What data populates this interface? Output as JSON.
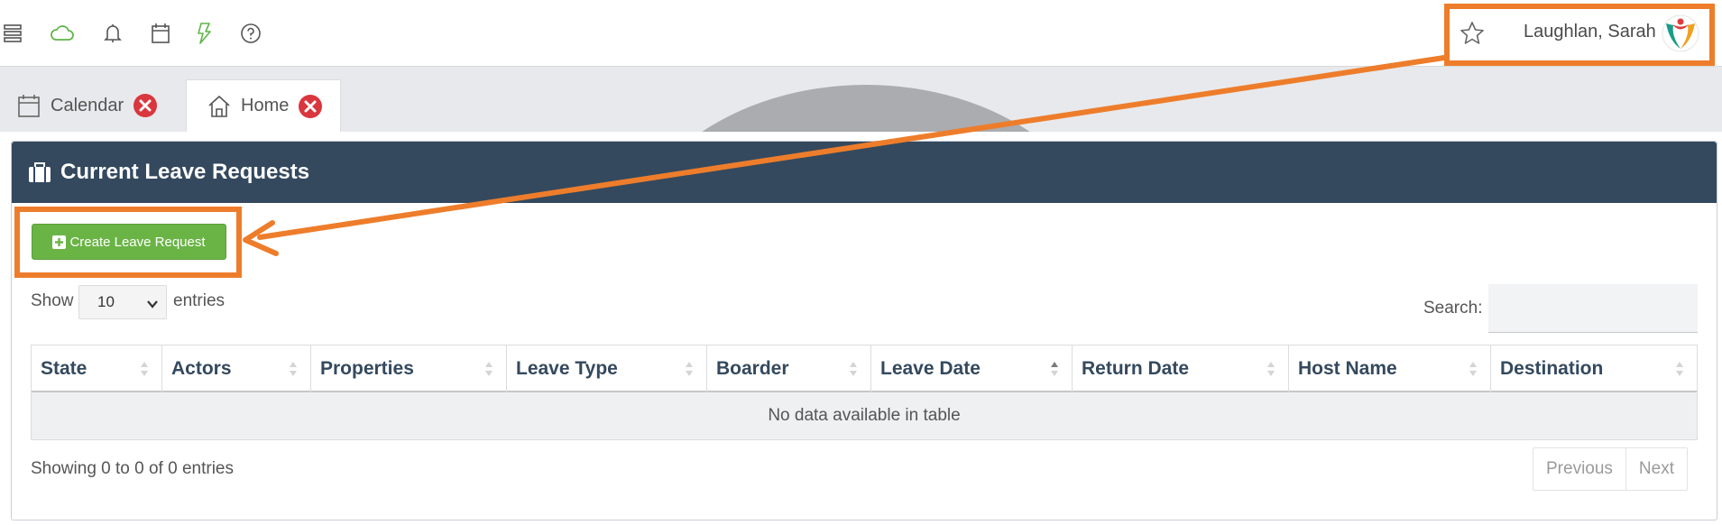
{
  "header": {
    "user_name": "Laughlan, Sarah",
    "icons": [
      "menu-stack-icon",
      "cloud-icon",
      "bell-icon",
      "calendar-icon",
      "lightning-icon",
      "help-icon",
      "star-icon"
    ]
  },
  "tabs": [
    {
      "label": "Calendar",
      "icon": "calendar-icon",
      "active": false
    },
    {
      "label": "Home",
      "icon": "home-icon",
      "active": true
    }
  ],
  "panel": {
    "title": "Current Leave Requests",
    "create_button": "Create Leave Request",
    "show_label": "Show",
    "entries_value": "10",
    "entries_label": "entries",
    "search_label": "Search:",
    "search_value": "",
    "columns": [
      "State",
      "Actors",
      "Properties",
      "Leave Type",
      "Boarder",
      "Leave Date",
      "Return Date",
      "Host Name",
      "Destination"
    ],
    "sorted_column": "Leave Date",
    "empty_message": "No data available in table",
    "info": "Showing 0 to 0 of 0 entries",
    "pager": {
      "previous": "Previous",
      "next": "Next"
    }
  },
  "colors": {
    "header_bg": "#34495e",
    "create_button_bg": "#6ab446",
    "annotation": "#ee7d2b",
    "close_badge": "#d9363e"
  }
}
